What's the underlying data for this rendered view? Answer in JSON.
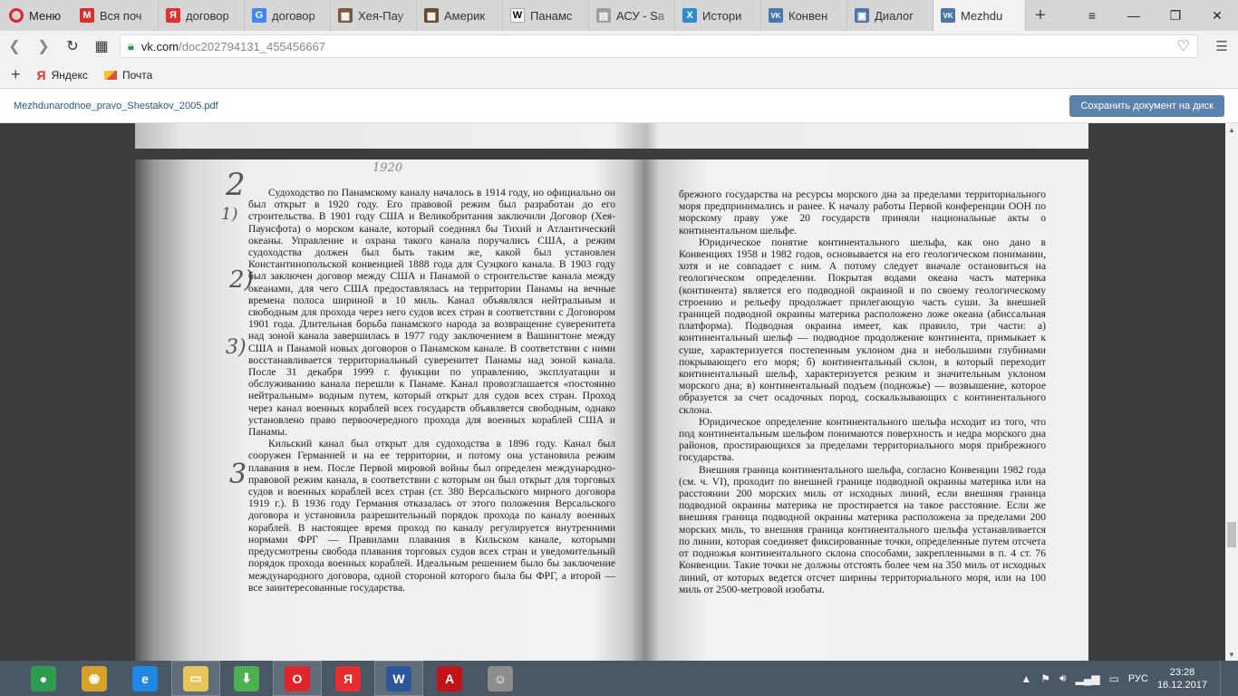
{
  "browser": {
    "menu_label": "Меню",
    "tabs": [
      {
        "label": "Вся поч",
        "icon": "gmail-icon",
        "color": "#d93025",
        "glyph": "M"
      },
      {
        "label": "договор",
        "icon": "yandex-icon",
        "color": "#e62e2e",
        "glyph": "Я"
      },
      {
        "label": "договор",
        "icon": "google-icon",
        "color": "#4285f4",
        "glyph": "G"
      },
      {
        "label": "Хея-Пау",
        "icon": "image-icon",
        "color": "#7a5a3a",
        "glyph": "▦"
      },
      {
        "label": "Америк",
        "icon": "image-icon",
        "color": "#6a4a2a",
        "glyph": "▦"
      },
      {
        "label": "Панамс",
        "icon": "wikipedia-icon",
        "color": "#ffffff",
        "glyph": "W"
      },
      {
        "label": "АСУ - Sa",
        "icon": "document-icon",
        "color": "#9e9e9e",
        "glyph": "▤"
      },
      {
        "label": "Истори",
        "icon": "x-icon",
        "color": "#2b8cd6",
        "glyph": "X"
      },
      {
        "label": "Конвен",
        "icon": "vk-icon",
        "color": "#4a76a8",
        "glyph": "VK"
      },
      {
        "label": "Диалог",
        "icon": "chat-icon",
        "color": "#4a76a8",
        "glyph": "▣"
      },
      {
        "label": "Mezhdu",
        "icon": "vk-icon",
        "color": "#4a76a8",
        "glyph": "VK",
        "active": true
      }
    ],
    "url_domain": "vk.com",
    "url_path": "/doc202794131_455456667",
    "bookmarks": [
      "Яндекс",
      "Почта"
    ]
  },
  "document": {
    "filename": "Mezhdunarodnoe_pravo_Shestakov_2005.pdf",
    "save_label": "Сохранить документ на диск",
    "top_note": "1920",
    "left_column": [
      "Судоходство по Панамскому каналу началось в 1914 году, но официально он был открыт в 1920 году. Его правовой режим был разработан до его строительства. В 1901 году США и Великобритания заключили Договор (Хея-Паунсфота) о морском канале, который соединял бы Тихий и Атлантический океаны. Управление и охрана такого канала поручались США, а режим судоходства должен был быть таким же, какой был установлен Константинопольской конвенцией 1888 года для Суэцкого канала. В 1903 году был заключен договор между США и Панамой о строительстве канала между океанами, для чего США предоставлялась на территории Панамы на вечные времена полоса шириной в 10 миль. Канал объявлялся нейтральным и свободным для прохода через него судов всех стран в соответствии с Договором 1901 года. Длительная борьба панамского народа за возвращение суверенитета над зоной канала завершилась в 1977 году заключением в Вашингтоне между США и Панамой новых договоров о Панамском канале. В соответствии с ними восстанавливается территориальный суверенитет Панамы над зоной канала. После 31 декабря 1999 г. функции по управлению, эксплуатации и обслуживанию канала перешли к Панаме. Канал провозглашается «постоянно нейтральным» водным путем, который открыт для судов всех стран. Проход через канал военных кораблей всех государств объявляется свободным, однако установлено право первоочередного прохода для военных кораблей США и Панамы.",
      "Кильский канал был открыт для судоходства в 1896 году. Канал был сооружен Германией и на ее территории, и потому она установила режим плавания в нем. После Первой мировой войны был определен международно-правовой режим канала, в соответствии с которым он был открыт для торговых судов и военных кораблей всех стран (ст. 380 Версальского мирного договора 1919 г.). В 1936 году Германия отказалась от этого положения Версальского договора и установила разрешительный порядок прохода по каналу военных кораблей. В настоящее время проход по каналу регулируется внутренними нормами ФРГ — Правилами плавания в Кильском канале, которыми предусмотрены свобода плавания торговых судов всех стран и уведомительный порядок прохода военных кораблей. Идеальным решением было бы заключение международного договора, одной стороной которого была бы ФРГ, а второй — все заинтересованные государства."
    ],
    "right_column": [
      "брежного государства на ресурсы морского дна за пределами территориального моря предпринимались и ранее. К началу работы Первой конференции ООН по морскому праву уже 20 государств приняли национальные акты о континентальном шельфе.",
      "Юридическое понятие континентального шельфа, как оно дано в Конвенциях 1958 и 1982 годов, основывается на его геологическом понимании, хотя и не совпадает с ним. А потому следует вначале остановиться на геологическом определении. Покрытая водами океана часть материка (континента) является его подводной окраиной и по своему геологическому строению и рельефу продолжает прилегающую часть суши. За внешней границей подводной окраины материка расположено ложе океана (абиссальная платформа). Подводная окраина имеет, как правило, три части: а) континентальный шельф — подводное продолжение континента, примыкает к суше, характеризуется постепенным уклоном дна и небольшими глубинами покрывающего его моря; б) континентальный склон, в который переходит континентальный шельф, характеризуется резким и значительным уклоном морского дна; в) континентальный подъем (подножье) — возвышение, которое образуется за счет осадочных пород, соскальзывающих с континентального склона.",
      "Юридическое определение континентального шельфа исходит из того, что под континентальным шельфом понимаются поверхность и недра морского дна районов, простирающихся за пределами территориального моря прибрежного государства.",
      "Внешняя граница континентального шельфа, согласно Конвенции 1982 года (см. ч. VI), проходит по внешней границе подводной окраины материка или на расстоянии 200 морских миль от исходных линий, если внешняя граница подводной окраины материка не простирается на такое расстояние. Если же внешняя граница подводной окраины материка расположена за пределами 200 морских миль, то внешняя граница континентального шельфа устанавливается по линии, которая соединяет фиксированные точки, определенные путем отсчета от подножья континентального склона способами, закрепленными в п. 4 ст. 76 Конвенции. Такие точки не должны отстоять более чем на 350 миль от исходных линий, от которых ведется отсчет ширины территориального моря, или на 100 миль от 2500-метровой изобаты."
    ]
  },
  "taskbar": {
    "apps": [
      {
        "name": "chrome",
        "glyph": "●",
        "color": "#2e9b4e"
      },
      {
        "name": "picasa",
        "glyph": "◉",
        "color": "#d7a22a"
      },
      {
        "name": "ie",
        "glyph": "e",
        "color": "#1e88e5"
      },
      {
        "name": "explorer",
        "glyph": "▭",
        "color": "#e8c45a",
        "open": true
      },
      {
        "name": "utorrent",
        "glyph": "⬇",
        "color": "#4caf50"
      },
      {
        "name": "opera",
        "glyph": "O",
        "color": "#e0242b",
        "open": true
      },
      {
        "name": "yandex",
        "glyph": "Я",
        "color": "#e62e2e"
      },
      {
        "name": "word",
        "glyph": "W",
        "color": "#2b579a",
        "open": true
      },
      {
        "name": "acrobat",
        "glyph": "A",
        "color": "#c4141b"
      },
      {
        "name": "student",
        "glyph": "☺",
        "color": "#8d8d8d"
      }
    ],
    "lang": "РУС",
    "time": "23:28",
    "date": "16.12.2017"
  }
}
